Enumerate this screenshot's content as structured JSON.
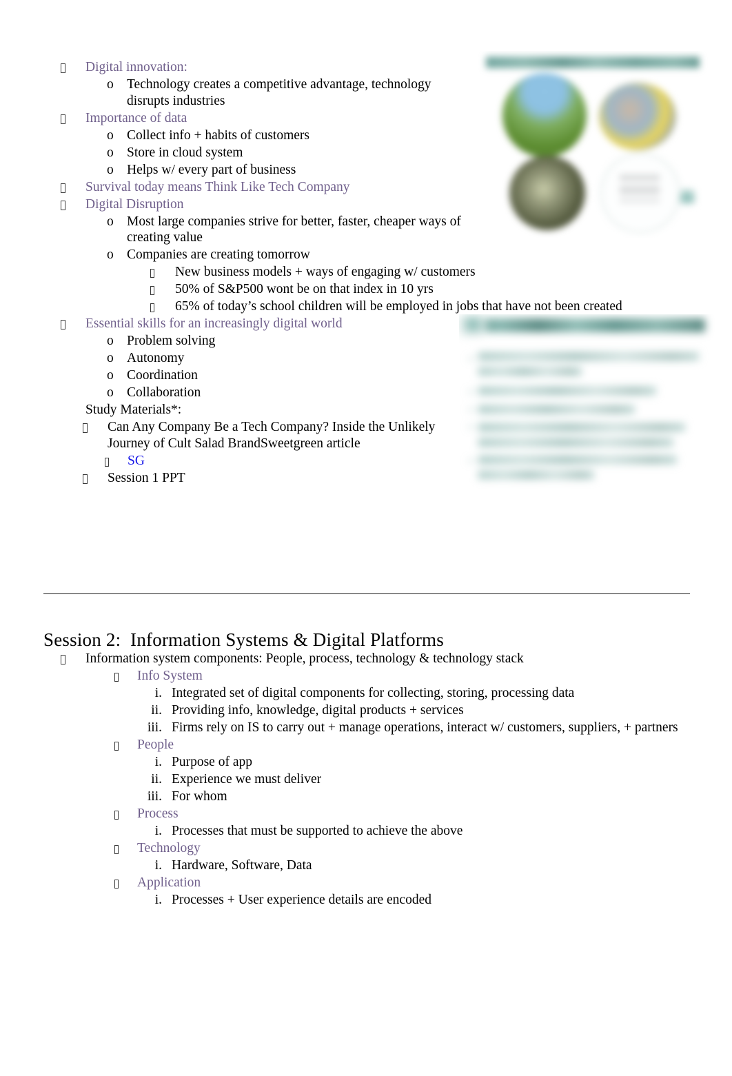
{
  "document": {
    "page_background": "#ffffff",
    "heading_color": "#70608C",
    "link_color": "#1616E8",
    "body_color": "#000000"
  },
  "section_1": {
    "items": [
      {
        "level": 1,
        "marker": "tofu",
        "text": "Digital innovation:",
        "style": "purple"
      },
      {
        "level": 2,
        "marker": "o",
        "text": "Technology creates a competitive advantage, technology disrupts industries",
        "style": "body"
      },
      {
        "level": 1,
        "marker": "tofu",
        "text": "Importance of data",
        "style": "purple"
      },
      {
        "level": 2,
        "marker": "o",
        "text": "Collect info + habits of customers",
        "style": "body"
      },
      {
        "level": 2,
        "marker": "o",
        "text": "Store in cloud system",
        "style": "body"
      },
      {
        "level": 2,
        "marker": "o",
        "text": "Helps w/ every part of business",
        "style": "body"
      },
      {
        "level": 1,
        "marker": "tofu",
        "text": "Survival today means Think Like Tech Company",
        "style": "purple"
      },
      {
        "level": 1,
        "marker": "tofu",
        "text": "Digital Disruption",
        "style": "purple"
      },
      {
        "level": 2,
        "marker": "o",
        "text": "Most large companies strive for better, faster, cheaper ways of creating value",
        "style": "body"
      },
      {
        "level": 2,
        "marker": "o",
        "text": "Companies are creating tomorrow",
        "style": "body"
      },
      {
        "level": 3,
        "marker": "tofu",
        "text": "New business models + ways of engaging w/ customers",
        "style": "body"
      },
      {
        "level": 3,
        "marker": "tofu",
        "text": "50% of S&P500 wont be on that index in 10 yrs",
        "style": "body"
      },
      {
        "level": 3,
        "marker": "tofu",
        "text": "65% of today’s school children will be employed in jobs that have not been created",
        "style": "body"
      },
      {
        "level": 1,
        "marker": "tofu",
        "text": "Essential skills for an increasingly digital world",
        "style": "purple"
      },
      {
        "level": 2,
        "marker": "o",
        "text": "Problem solving",
        "style": "body"
      },
      {
        "level": 2,
        "marker": "o",
        "text": "Autonomy",
        "style": "body"
      },
      {
        "level": 2,
        "marker": "o",
        "text": "Coordination",
        "style": "body"
      },
      {
        "level": 2,
        "marker": "o",
        "text": "Collaboration",
        "style": "body"
      }
    ],
    "study_materials_label": "Study Materials*:",
    "study_materials": [
      {
        "marker": "tofu",
        "text": "Can Any Company Be a Tech Company? Inside the Unlikely Journey of Cult Salad BrandSweetgreen article",
        "style": "body"
      },
      {
        "marker": "tofu",
        "text": "SG",
        "style": "link"
      },
      {
        "marker": "tofu",
        "text": "Session 1 PPT",
        "style": "body"
      }
    ]
  },
  "session_2": {
    "heading": "Session 2:  Information Systems & Digital Platforms",
    "items": [
      {
        "level": 1,
        "marker": "tofu",
        "text": "Information system components: People, process, technology & technology stack",
        "style": "body"
      },
      {
        "level": 2,
        "marker": "tofu",
        "text": "Info System",
        "style": "purple"
      },
      {
        "level": 3,
        "marker": "i.",
        "text": "Integrated set of digital components for collecting, storing, processing data",
        "style": "body"
      },
      {
        "level": 3,
        "marker": "ii.",
        "text": "Providing info, knowledge, digital products + services",
        "style": "body"
      },
      {
        "level": 3,
        "marker": "iii.",
        "text": "Firms rely on IS to carry out + manage operations, interact w/ customers, suppliers, + partners",
        "style": "body"
      },
      {
        "level": 2,
        "marker": "tofu",
        "text": "People",
        "style": "purple"
      },
      {
        "level": 3,
        "marker": "i.",
        "text": "Purpose of app",
        "style": "body"
      },
      {
        "level": 3,
        "marker": "ii.",
        "text": "Experience we must deliver",
        "style": "body"
      },
      {
        "level": 3,
        "marker": "iii.",
        "text": "For whom",
        "style": "body"
      },
      {
        "level": 2,
        "marker": "tofu",
        "text": "Process",
        "style": "purple"
      },
      {
        "level": 3,
        "marker": "i.",
        "text": "Processes that must be supported to achieve the above",
        "style": "body"
      },
      {
        "level": 2,
        "marker": "tofu",
        "text": "Technology",
        "style": "purple"
      },
      {
        "level": 3,
        "marker": "i.",
        "text": "Hardware, Software, Data",
        "style": "body"
      },
      {
        "level": 2,
        "marker": "tofu",
        "text": "Application",
        "style": "purple"
      },
      {
        "level": 3,
        "marker": "i.",
        "text": "Processes + User experience details are encoded",
        "style": "body"
      }
    ]
  },
  "images": {
    "top_slide": {
      "name": "blurred-slide-screenshot-circles",
      "description": "Blurred presentation slide with a teal title banner and four circular photographs",
      "accent_color": "#4e8f86"
    },
    "bottom_slide": {
      "name": "blurred-slide-screenshot-bullets",
      "description": "Blurred presentation slide with a teal title bar and five teal bullet lines",
      "accent_color": "#3f8278"
    }
  }
}
